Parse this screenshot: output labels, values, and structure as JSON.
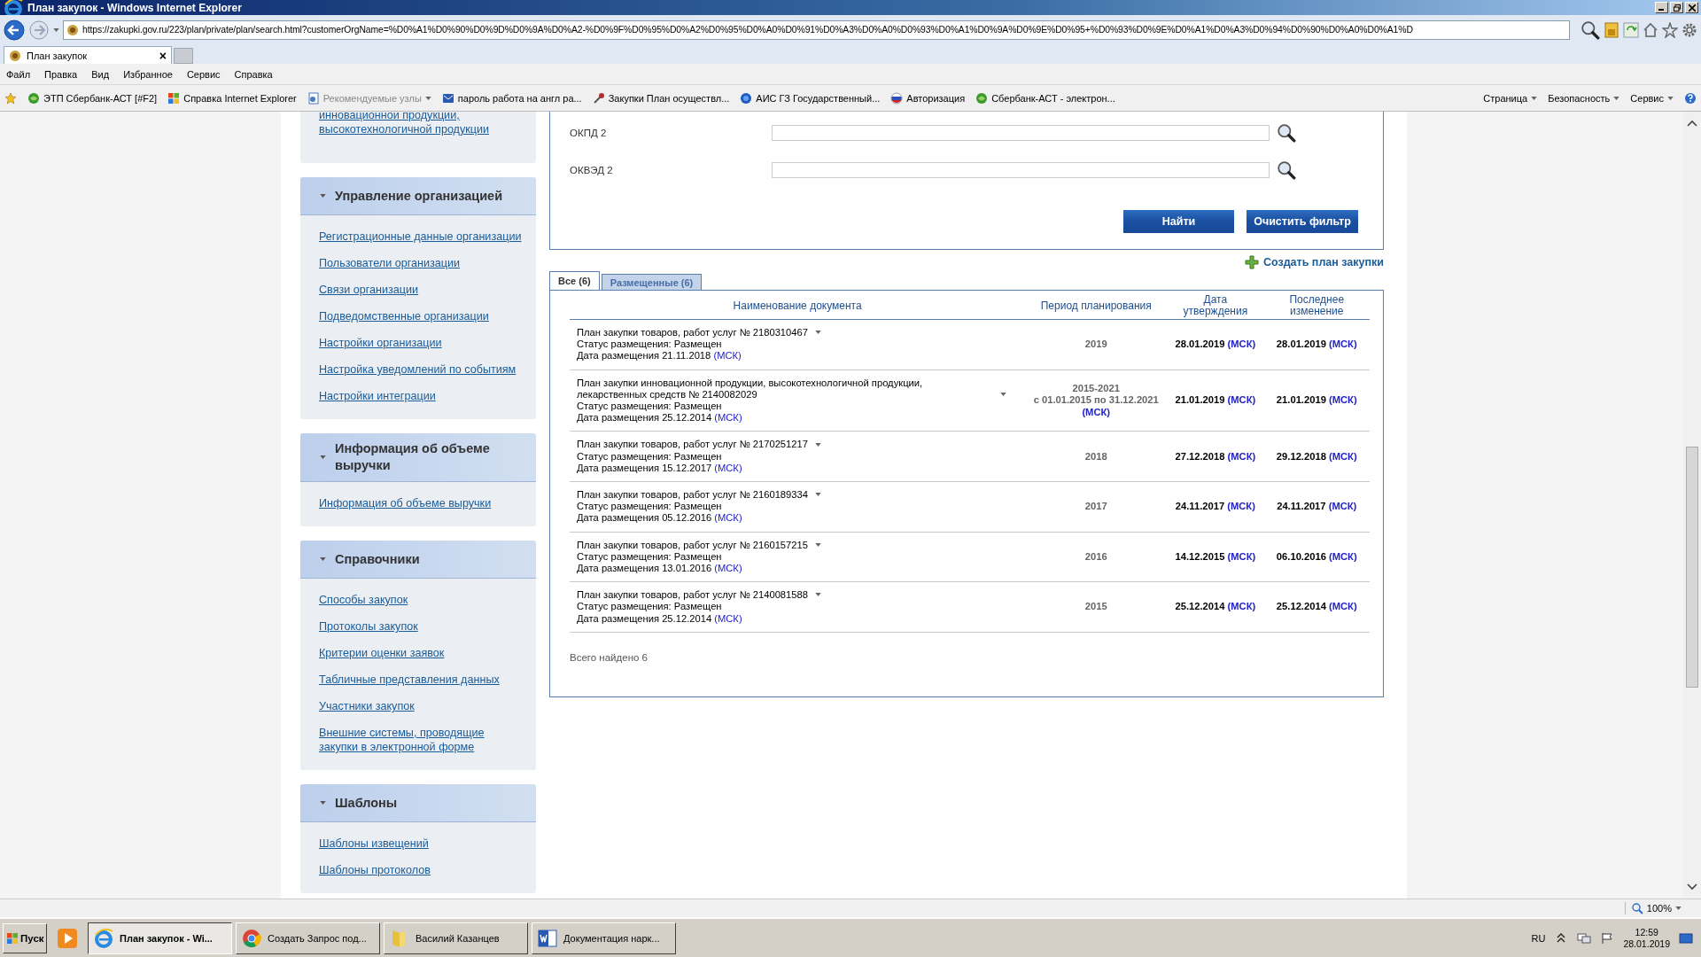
{
  "window": {
    "title": "План закупок - Windows Internet Explorer"
  },
  "address": {
    "value": "https://zakupki.gov.ru/223/plan/private/plan/search.html?customerOrgName=%D0%A1%D0%90%D0%9D%D0%9A%D0%A2-%D0%9F%D0%95%D0%A2%D0%95%D0%A0%D0%91%D0%A3%D0%A0%D0%93%D0%A1%D0%9A%D0%9E%D0%95+%D0%93%D0%9E%D0%A1%D0%A3%D0%94%D0%90%D0%A0%D0%A1%D"
  },
  "browser_tab": {
    "label": "План закупок",
    "close": "×"
  },
  "menu": [
    "Файл",
    "Правка",
    "Вид",
    "Избранное",
    "Сервис",
    "Справка"
  ],
  "favorites": [
    {
      "kind": "globe",
      "label": "ЭТП Сбербанк-АСТ [#F2]",
      "disabled": false
    },
    {
      "kind": "windows",
      "label": "Справка Internet Explorer",
      "disabled": false
    },
    {
      "kind": "page",
      "label": "Рекомендуемые узлы",
      "disabled": true
    },
    {
      "kind": "mail",
      "label": "пароль работа на англ ра...",
      "disabled": false
    },
    {
      "kind": "tool",
      "label": "Закупки  План осуществл...",
      "disabled": false
    },
    {
      "kind": "shield",
      "label": "АИС ГЗ  Государственный...",
      "disabled": false
    },
    {
      "kind": "flag",
      "label": "Авторизация",
      "disabled": false
    },
    {
      "kind": "globe",
      "label": "Сбербанк-АСТ - электрон...",
      "disabled": false
    }
  ],
  "command_bar": [
    "Страница",
    "Безопасность",
    "Сервис"
  ],
  "sidebar": [
    {
      "links": [
        "инновационной продукции, высокотехнологичной продукции"
      ]
    },
    {
      "title": "Управление организацией",
      "expanded": true,
      "links": [
        "Регистрационные данные организации",
        "Пользователи организации",
        "Связи организации",
        "Подведомственные организации",
        "Настройки организации",
        "Настройка уведомлений по событиям",
        "Настройки интеграции"
      ]
    },
    {
      "title": "Информация об объеме выручки",
      "expanded": true,
      "links": [
        "Информация об объеме выручки"
      ]
    },
    {
      "title": "Справочники",
      "expanded": true,
      "links": [
        "Способы закупок",
        "Протоколы закупок",
        "Критерии оценки заявок",
        "Табличные представления данных",
        "Участники закупок",
        "Внешние системы, проводящие закупки в электронной форме"
      ]
    },
    {
      "title": "Шаблоны",
      "expanded": true,
      "links": [
        "Шаблоны извещений",
        "Шаблоны протоколов"
      ]
    }
  ],
  "filter": {
    "fields": [
      {
        "label": "ОКПД 2"
      },
      {
        "label": "ОКВЭД 2"
      }
    ],
    "buttons": [
      "Найти",
      "Очистить фильтр"
    ]
  },
  "create_link": "Создать план закупки",
  "tabs": [
    {
      "label": "Все (6)",
      "selected": true
    },
    {
      "label": "Размещенные (6)",
      "selected": false
    }
  ],
  "table": {
    "columns": [
      "Наименование документа",
      "Период планирования",
      "Дата утверждения",
      "Последнее изменение"
    ],
    "rows": [
      {
        "title": "План закупки товаров, работ услуг № 2180310467",
        "status": "Статус размещения: Размещен",
        "posted": "Дата размещения 21.11.2018",
        "posted_tz": "(МСК)",
        "period": [
          "2019"
        ],
        "approved": "28.01.2019",
        "approved_tz": "(МСК)",
        "modified": "28.01.2019",
        "modified_tz": "(МСК)"
      },
      {
        "title": "План закупки инновационной продукции, высокотехнологичной продукции, лекарственных средств № 2140082029",
        "status": "Статус размещения: Размещен",
        "posted": "Дата размещения 25.12.2014",
        "posted_tz": "(МСК)",
        "period": [
          "2015-2021",
          "с 01.01.2015 по 31.12.2021"
        ],
        "period_tz": "(МСК)",
        "approved": "21.01.2019",
        "approved_tz": "(МСК)",
        "modified": "21.01.2019",
        "modified_tz": "(МСК)"
      },
      {
        "title": "План закупки товаров, работ услуг № 2170251217",
        "status": "Статус размещения: Размещен",
        "posted": "Дата размещения 15.12.2017",
        "posted_tz": "(МСК)",
        "period": [
          "2018"
        ],
        "approved": "27.12.2018",
        "approved_tz": "(МСК)",
        "modified": "29.12.2018",
        "modified_tz": "(МСК)"
      },
      {
        "title": "План закупки товаров, работ услуг № 2160189334",
        "status": "Статус размещения: Размещен",
        "posted": "Дата размещения 05.12.2016",
        "posted_tz": "(МСК)",
        "period": [
          "2017"
        ],
        "approved": "24.11.2017",
        "approved_tz": "(МСК)",
        "modified": "24.11.2017",
        "modified_tz": "(МСК)"
      },
      {
        "title": "План закупки товаров, работ услуг № 2160157215",
        "status": "Статус размещения: Размещен",
        "posted": "Дата размещения 13.01.2016",
        "posted_tz": "(МСК)",
        "period": [
          "2016"
        ],
        "approved": "14.12.2015",
        "approved_tz": "(МСК)",
        "modified": "06.10.2016",
        "modified_tz": "(МСК)"
      },
      {
        "title": "План закупки товаров, работ услуг № 2140081588",
        "status": "Статус размещения: Размещен",
        "posted": "Дата размещения 25.12.2014",
        "posted_tz": "(МСК)",
        "period": [
          "2015"
        ],
        "approved": "25.12.2014",
        "approved_tz": "(МСК)",
        "modified": "25.12.2014",
        "modified_tz": "(МСК)"
      }
    ]
  },
  "total": "Всего найдено 6",
  "status_bar": {
    "zoom": "100%"
  },
  "taskbar": {
    "start": "Пуск",
    "tasks": [
      {
        "kind": "ie",
        "label": "План закупок - Wi...",
        "selected": true
      },
      {
        "kind": "chrome",
        "label": "Создать Запрос под...",
        "selected": false
      },
      {
        "kind": "folder",
        "label": "Василий Казанцев",
        "selected": false
      },
      {
        "kind": "word",
        "label": "Документация нарк...",
        "selected": false
      }
    ],
    "language": "RU",
    "time": "12:59",
    "date": "28.01.2019"
  }
}
